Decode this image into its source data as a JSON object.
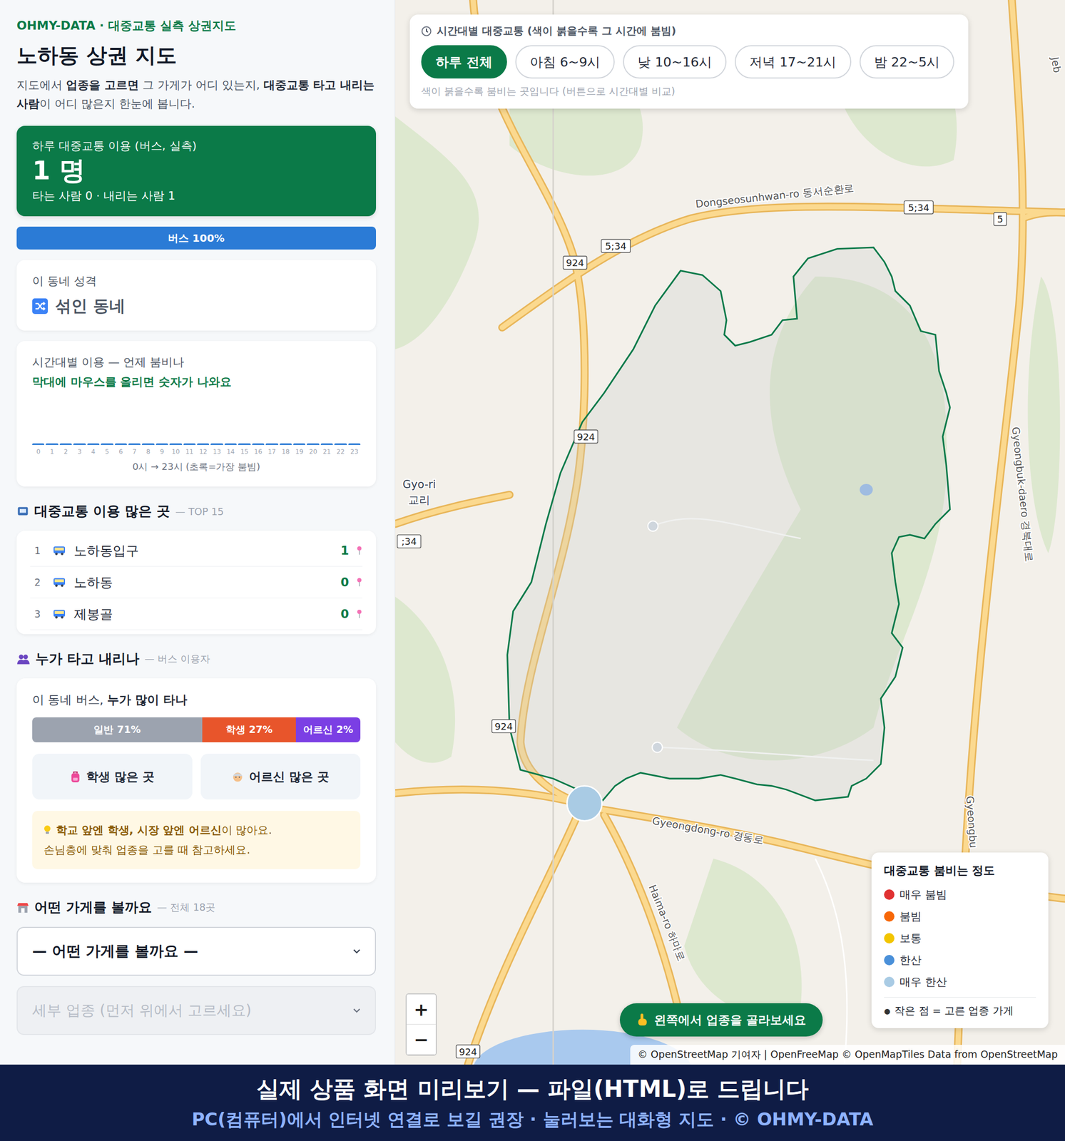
{
  "sidebar": {
    "brand": "OHMY-DATA · 대중교통 실측 상권지도",
    "title": "노하동 상권 지도",
    "description": [
      {
        "text": "지도에서 ",
        "bold": false
      },
      {
        "text": "업종을 고르면",
        "bold": true
      },
      {
        "text": " 그 가게가 어디 있는지, ",
        "bold": false
      },
      {
        "text": "대중교통 타고 내리는 사람",
        "bold": true
      },
      {
        "text": "이 어디 많은지 한눈에 봅니다.",
        "bold": false
      }
    ],
    "summary": {
      "label": "하루 대중교통 이용 (버스, 실측)",
      "value": "1 명",
      "detail": "타는 사람 0 · 내리는 사람 1"
    },
    "modeBar": [
      {
        "label": "버스 100%",
        "level": 1,
        "color": "#2b7bd6"
      }
    ],
    "character": {
      "label": "이 동네 성격",
      "value": "섞인 동네"
    },
    "hourly": {
      "title": "시간대별 이용 — 언제 붐비나",
      "hint": "막대에 마우스를 올리면 숫자가 나와요",
      "values": [
        0,
        0,
        0,
        0,
        0,
        0,
        0,
        0,
        0,
        0,
        0,
        0,
        0,
        0,
        0,
        0,
        0,
        0,
        0,
        0,
        0,
        0,
        0,
        0
      ],
      "ticks": [
        "0",
        "1",
        "2",
        "3",
        "4",
        "5",
        "6",
        "7",
        "8",
        "9",
        "10",
        "11",
        "12",
        "13",
        "14",
        "15",
        "16",
        "17",
        "18",
        "19",
        "20",
        "21",
        "22",
        "23"
      ],
      "caption": "0시 → 23시 (초록=가장 붐빔)"
    },
    "ranking": {
      "title": "대중교통 이용 많은 곳",
      "sub": "— TOP 15",
      "rows": [
        {
          "rank": "1",
          "name": "노하동입구",
          "count": "1"
        },
        {
          "rank": "2",
          "name": "노하동",
          "count": "0"
        },
        {
          "rank": "3",
          "name": "제봉골",
          "count": "0"
        }
      ]
    },
    "riders": {
      "title": "누가 타고 내리나",
      "sub": "— 버스 이용자",
      "heading": [
        {
          "text": "이 동네 버스, ",
          "bold": false
        },
        {
          "text": "누가 많이 타나",
          "bold": true
        }
      ],
      "segments": [
        {
          "label": "일반 71%",
          "level": 0.71,
          "color": "#9ca3af"
        },
        {
          "label": "학생 27%",
          "level": 0.27,
          "color": "#e8552b"
        },
        {
          "label": "어르신 2%",
          "level": 0.02,
          "color": "#7b3fe4"
        }
      ],
      "buttons": [
        {
          "label": "학생 많은 곳",
          "kind": "student"
        },
        {
          "label": "어르신 많은 곳",
          "kind": "elder"
        }
      ],
      "note": [
        [
          {
            "text": "학교 앞엔 학생, 시장 앞엔 어르신",
            "bold": true
          },
          {
            "text": "이 많아요.",
            "bold": false
          }
        ],
        [
          {
            "text": "손님층에 맞춰 업종을 고를 때 참고하세요.",
            "bold": false
          }
        ]
      ]
    },
    "shops": {
      "title": "어떤 가게를 볼까요",
      "sub": "— 전체 18곳",
      "select": {
        "value": "— 어떤 가게를 볼까요 —",
        "disabled": false
      },
      "subSelect": {
        "placeholder": "세부 업종 (먼저 위에서 고르세요)",
        "disabled": true
      }
    }
  },
  "map": {
    "control": {
      "title": "시간대별 대중교통 (색이 붉을수록 그 시간에 붐빔)",
      "tabs": [
        {
          "label": "하루 전체",
          "selected": true
        },
        {
          "label": "아침 6~9시",
          "selected": false
        },
        {
          "label": "낮 10~16시",
          "selected": false
        },
        {
          "label": "저녁 17~21시",
          "selected": false
        },
        {
          "label": "밤 22~5시",
          "selected": false
        }
      ],
      "hint": "색이 붉을수록 붐비는 곳입니다 (버튼으로 시간대별 비교)"
    },
    "labels": [
      {
        "text": "Dongseosunhwan-ro 동서순환로",
        "kind": "road"
      },
      {
        "text": "5;34",
        "kind": "shield"
      },
      {
        "text": "5",
        "kind": "shield"
      },
      {
        "text": "5;34",
        "kind": "shield"
      },
      {
        "text": "924",
        "kind": "shield"
      },
      {
        "text": "924",
        "kind": "shield"
      },
      {
        "text": "924",
        "kind": "shield"
      },
      {
        "text": "924",
        "kind": "shield"
      },
      {
        "text": ";34",
        "kind": "shield"
      },
      {
        "text": "Gyo-ri",
        "kind": "place"
      },
      {
        "text": "교리",
        "kind": "place"
      },
      {
        "text": "Gyeongdong-ro 경동로",
        "kind": "road"
      },
      {
        "text": "Haima-ro 하마로",
        "kind": "road"
      },
      {
        "text": "Gyeongbuk-daero 경북대로",
        "kind": "road"
      },
      {
        "text": "Gyeongbu",
        "kind": "road"
      },
      {
        "text": "Jeb",
        "kind": "road"
      }
    ],
    "stops": [
      {
        "color": "#a9cbe4"
      }
    ],
    "zoom": [
      "+",
      "−"
    ],
    "prompt": "왼쪽에서 업종을 골라보세요",
    "legend": {
      "title": "대중교통 붐비는 정도",
      "items": [
        {
          "label": "매우 붐빔",
          "color": "#e03131"
        },
        {
          "label": "붐빔",
          "color": "#f76707"
        },
        {
          "label": "보통",
          "color": "#f2c500"
        },
        {
          "label": "한산",
          "color": "#4a90d9"
        },
        {
          "label": "매우 한산",
          "color": "#a9cbe4"
        }
      ],
      "marker": "●",
      "note": "작은 점 = 고른 업종 가게"
    },
    "attribution": "© OpenStreetMap 기여자 | OpenFreeMap © OpenMapTiles Data from OpenStreetMap"
  },
  "banner": {
    "line1": "실제 상품 화면 미리보기 — 파일(HTML)로 드립니다",
    "line2": "PC(컴퓨터)에서 인터넷 연결로 보길 권장 · 눌러보는 대화형 지도 · © OHMY-DATA"
  }
}
